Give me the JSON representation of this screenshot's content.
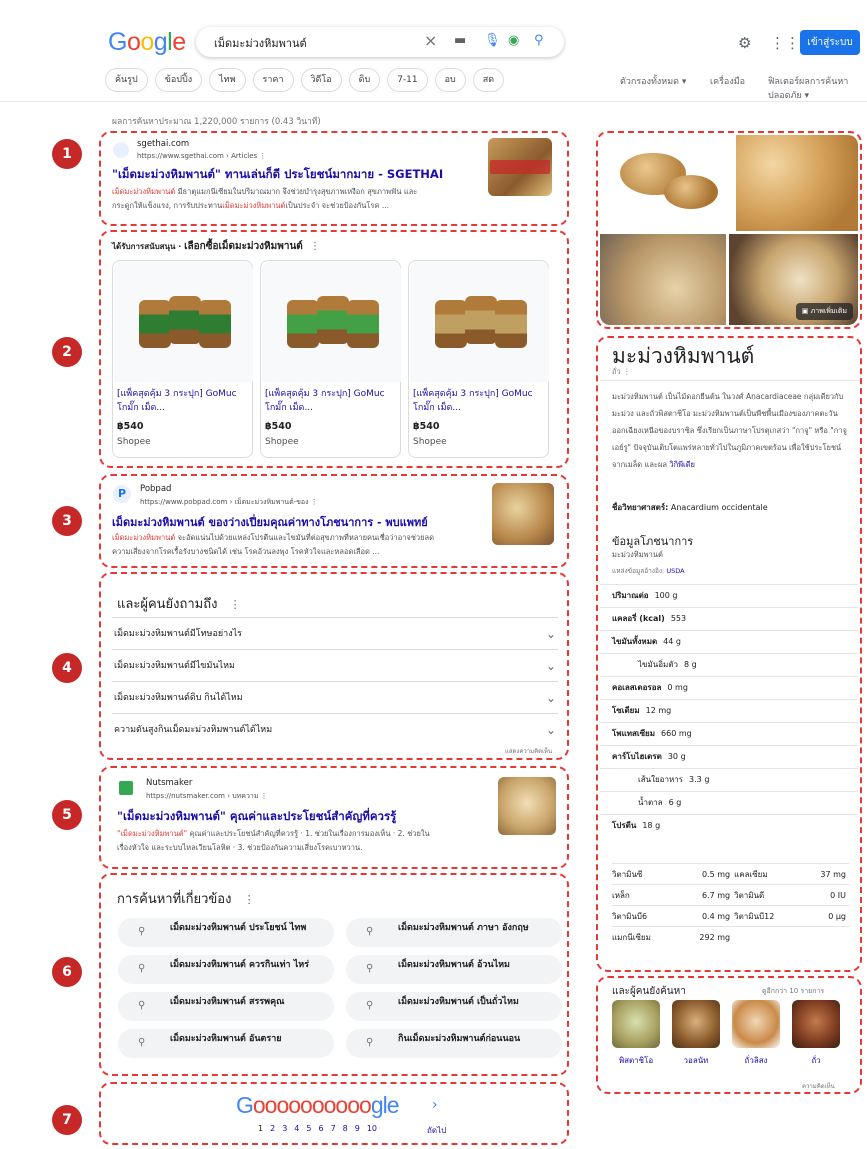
{
  "header": {
    "logo_text": "Google",
    "logo_colors": [
      "#4285F4",
      "#EA4335",
      "#FBBC05",
      "#4285F4",
      "#34A853",
      "#EA4335"
    ],
    "search_query": "เม็ดมะม่วงหิมพานต์",
    "sign_in_label": "เข้าสู่ระบบ"
  },
  "chips": [
    "ค้นรูป",
    "ข้อปปิ้ง",
    "ไทพ",
    "ราคา",
    "วิดีโอ",
    "ดิบ",
    "7-11",
    "อบ",
    "สด"
  ],
  "tools": {
    "all_filters": "ตัวกรองทั้งหมด ▾",
    "tools": "เครื่องมือ",
    "safesearch": "ฟิลเตอร์ผลการค้นหาปลอดภัย ▾"
  },
  "result_stats": "ผลการค้นหาประมาณ 1,220,000 รายการ (0.43 วินาที)",
  "markers": [
    "1",
    "2",
    "3",
    "4",
    "5",
    "6",
    "7"
  ],
  "result1": {
    "site": "sgethai.com",
    "url": "https://www.sgethai.com › Articles ⋮",
    "title": "\"เม็ดมะม่วงหิมพานต์\" ทานเล่นก็ดี ประโยชน์มากมาย - SGETHAI",
    "snippet_em": "เม็ดมะม่วงหิมพานต์",
    "snippet_1": " มีธาตุแมกนีเซียมในปริมาณมาก จึงช่วยบำรุงสุขภาพเหงือก สุขภาพฟัน และ",
    "snippet_2": "กระดูกให้แข็งแรง, การรับประทาน",
    "snippet_em2": "เม็ดมะม่วงหิมพานต์",
    "snippet_3": "เป็นประจำ จะช่วยป้องกันโรค ..."
  },
  "shopping": {
    "heading_prefix": "ได้รับการสนับสนุน · ",
    "heading": "เลือกซื้อเม็ดมะม่วงหิมพานต์",
    "more": "⋮",
    "items": [
      {
        "title": "[แพ็คสุดคุ้ม 3 กระปุก] GoMuc โกมั๊ก เม็ด...",
        "price": "฿540",
        "store": "Shopee"
      },
      {
        "title": "[แพ็คสุดคุ้ม 3 กระปุก] GoMuc โกมั๊ก เม็ด...",
        "price": "฿540",
        "store": "Shopee"
      },
      {
        "title": "[แพ็คสุดคุ้ม 3 กระปุก] GoMuc โกมั๊ก เม็ด...",
        "price": "฿540",
        "store": "Shopee"
      }
    ]
  },
  "result3": {
    "favicon_letter": "P",
    "site": "Pobpad",
    "url": "https://www.pobpad.com › เม็ดมะม่วงหิมพานต์-ของ ⋮",
    "title": "เม็ดมะม่วงหิมพานต์ ของว่างเปี่ยมคุณค่าทางโภชนาการ - พบแพทย์",
    "snippet_em": "เม็ดมะม่วงหิมพานต์",
    "snippet_1": " จะอัดแน่นไปด้วยแหล่งโปรตีนและไขมันที่ต่อสุขภาพที่หลายคนเชื่อว่าอาจช่วยลด",
    "snippet_2": "ความเสี่ยงจากโรคเรื้อรังบางชนิดได้ เช่น โรคอ้วนลงพุง โรคหัวใจและหลอดเลือด ..."
  },
  "paa": {
    "heading": "และผู้คนยังถามถึง",
    "more": "⋮",
    "questions": [
      "เม็ดมะม่วงหิมพานต์มีโทษอย่างไร",
      "เม็ดมะม่วงหิมพานต์มีไขมันไหม",
      "เม็ดมะม่วงหิมพานต์ดิบ กินได้ไหม",
      "ความดันสูงกินเม็ดมะม่วงหิมพานต์ได้ไหม"
    ],
    "feedback": "แสดงความคิดเห็น"
  },
  "result5": {
    "site": "Nutsmaker",
    "url": "https://nutsmaker.com › บทความ ⋮",
    "title": "\"เม็ดมะม่วงหิมพานต์\" คุณค่าและประโยชน์สำคัญที่ควรรู้",
    "snippet_em": "\"เม็ดมะม่วงหิมพานต์\"",
    "snippet_1": " คุณค่าและประโยชน์สำคัญที่ควรรู้ · 1. ช่วยในเรื่องการมองเห็น · 2. ช่วยใน",
    "snippet_2": "เรื่องหัวใจ และระบบไหลเวียนโลหิต · 3. ช่วยป้องกันความเสี่ยงโรคเบาหวาน."
  },
  "related": {
    "heading": "การค้นหาที่เกี่ยวข้อง",
    "more": "⋮",
    "items": [
      "เม็ดมะม่วงหิมพานต์ ประโยชน์ ไทพ",
      "เม็ดมะม่วงหิมพานต์ ภาษา อังกฤษ",
      "เม็ดมะม่วงหิมพานต์ ควรกินเท่า ไหร่",
      "เม็ดมะม่วงหิมพานต์ อ้วนไหม",
      "เม็ดมะม่วงหิมพานต์ สรรพคุณ",
      "เม็ดมะม่วงหิมพานต์ เป็นถั่วไหม",
      "เม็ดมะม่วงหิมพานต์ อันตราย",
      "กินเม็ดมะม่วงหิมพานต์ก่อนนอน"
    ]
  },
  "pagination": {
    "logo_g": "G",
    "logo_os": "oooooooooo",
    "logo_gle": "gle",
    "next_arrow": "›",
    "pages": [
      "1",
      "2",
      "3",
      "4",
      "5",
      "6",
      "7",
      "8",
      "9",
      "10"
    ],
    "next": "ถัดไป"
  },
  "knowledge_panel": {
    "images_label": "ภาพเพิ่มเติม",
    "title": "มะม่วงหิมพานต์",
    "subtitle": "ถั่ว ⋮",
    "description": "มะม่วงหิมพานต์ เป็นไม้ดอกยืนต้น ในวงศ์ Anacardiaceae กลุ่มเดียวกับมะม่วง และถั่วพิสตาชิโอ มะม่วงหิมพานต์เป็นพืชพื้นเมืองของภาคตะวันออกเฉียงเหนือของบราซิล ซึ่งเรียกเป็นภาษาโปรตุเกสว่า \"กาจู\" หรือ \"กาจูเอย์รู\" ปัจจุบันเติบโตแพร่หลายทั่วไปในภูมิภาคเขตร้อน เพื่อใช้ประโยชน์จากเมล็ด และผล",
    "more_link": "วิกิพีเดีย",
    "sci_label": "ชื่อวิทยาศาสตร์:",
    "sci_value": "Anacardium occidentale",
    "nutrition_heading": "ข้อมูลโภชนาการ",
    "nutrition_sub": "มะม่วงหิมพานต์",
    "source_prefix": "แหล่งข้อมูลอ้างอิง: ",
    "source": "USDA",
    "rows": [
      {
        "label": "ปริมาณต่อ",
        "value": "100 g",
        "indent": false
      },
      {
        "label": "แคลอรี่ (kcal)",
        "value": "553",
        "indent": false
      },
      {
        "label": "ไขมันทั้งหมด",
        "value": "44 g",
        "indent": false
      },
      {
        "label": "ไขมันอิ่มตัว",
        "value": "8 g",
        "indent": true
      },
      {
        "label": "คอเลสเตอรอล",
        "value": "0 mg",
        "indent": false
      },
      {
        "label": "โซเดียม",
        "value": "12 mg",
        "indent": false
      },
      {
        "label": "โพแทสเซียม",
        "value": "660 mg",
        "indent": false
      },
      {
        "label": "คาร์โบไฮเดรต",
        "value": "30 g",
        "indent": false
      },
      {
        "label": "เส้นใยอาหาร",
        "value": "3.3 g",
        "indent": true
      },
      {
        "label": "น้ำตาล",
        "value": "6 g",
        "indent": true
      },
      {
        "label": "โปรตีน",
        "value": "18 g",
        "indent": false
      }
    ],
    "vitamins": [
      [
        "วิตามินซี",
        "0.5 mg",
        "แคลเซียม",
        "37 mg"
      ],
      [
        "เหล็ก",
        "6.7 mg",
        "วิตามินดี",
        "0 IU"
      ],
      [
        "วิตามินบี6",
        "0.4 mg",
        "วิตามินบี12",
        "0 µg"
      ],
      [
        "แมกนีเซียม",
        "292 mg",
        "",
        ""
      ]
    ]
  },
  "pasf": {
    "heading": "และผู้คนยังค้นหา",
    "more": "ดูอีกกว่า 10 รายการ",
    "items": [
      "พิสตาชิโอ",
      "วอลนัท",
      "ถั่วลิสง",
      "ถั่ว"
    ],
    "feedback": "ความคิดเห็น"
  }
}
